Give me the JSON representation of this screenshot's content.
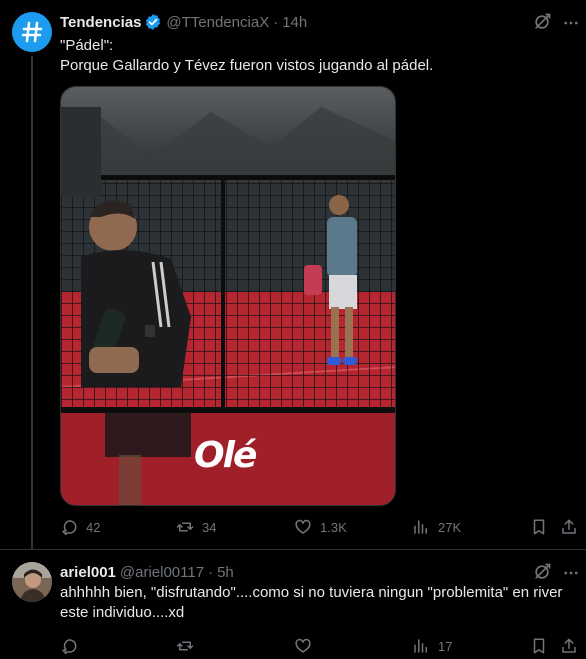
{
  "tweet1": {
    "display_name": "Tendencias",
    "handle": "@TTendenciaX",
    "separator": "·",
    "time": "14h",
    "avatar_glyph": "#",
    "text_line1": "\"Pádel\":",
    "text_line2": "Porque Gallardo y Tévez fueron vistos jugando al pádel.",
    "media_watermark": "Olé",
    "stats": {
      "replies": "42",
      "reposts": "34",
      "likes": "1.3K",
      "views": "27K"
    }
  },
  "tweet2": {
    "display_name": "ariel001",
    "handle": "@ariel00117",
    "separator": "·",
    "time": "5h",
    "text": "ahhhhh bien, \"disfrutando\"....como si no tuviera ningun \"problemita\" en river este individuo....xd",
    "stats": {
      "replies": "",
      "reposts": "",
      "likes": "",
      "views": "17"
    }
  },
  "icons": {
    "verified": "verified-badge-icon",
    "grok": "grok-icon",
    "more": "more-icon",
    "reply": "reply-icon",
    "repost": "repost-icon",
    "like": "like-icon",
    "views": "views-icon",
    "bookmark": "bookmark-icon",
    "share": "share-icon"
  },
  "colors": {
    "background": "#000000",
    "text": "#e7e9ea",
    "muted": "#71767b",
    "brand": "#1d9bf0",
    "divider": "#2f3336"
  }
}
